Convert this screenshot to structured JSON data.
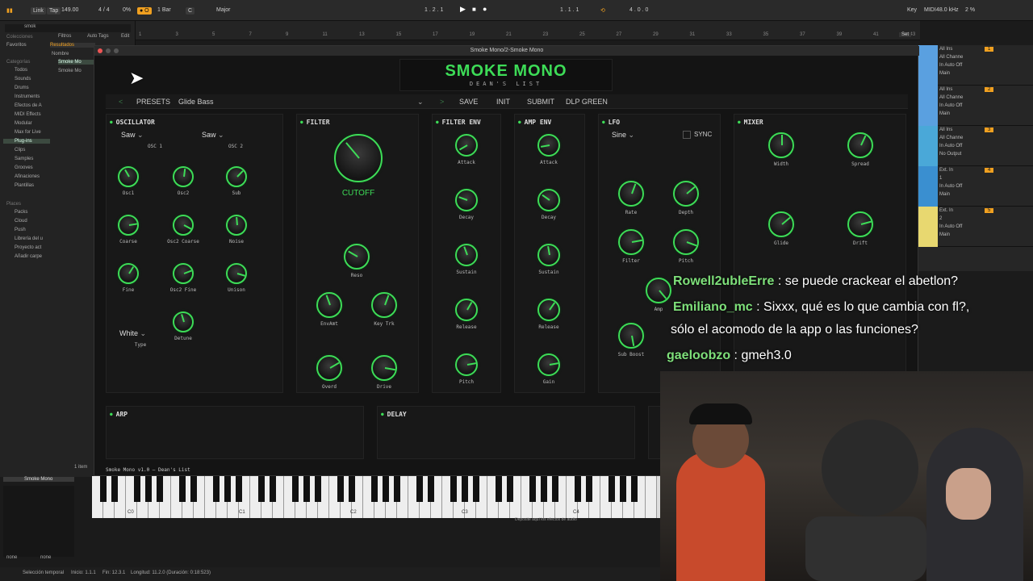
{
  "transport": {
    "link": "Link",
    "tap": "Tap",
    "tempo": "149.00",
    "sig": "4 / 4",
    "cpu": "0%",
    "quant": "1 Bar",
    "key": "C",
    "scale": "Major",
    "pos1": "1 . 2 . 1",
    "pos2": "1 . 1 . 1",
    "loop_len": "4 . 0 . 0",
    "key_label": "Key",
    "midi": "MIDI",
    "sr": "48.0 kHz",
    "load": "2 %"
  },
  "browser": {
    "search": "smok",
    "sections": {
      "collections": "Colecciones",
      "categories": "Categorías",
      "places": "Places"
    },
    "collections": [
      "Favoritos"
    ],
    "categories": [
      "Todos",
      "Sounds",
      "Drums",
      "Instruments",
      "Efectos de A",
      "MIDI Effects",
      "Modular",
      "Max for Live",
      "Plug-ins",
      "Clips",
      "Samples",
      "Grooves",
      "Afinaciones",
      "Plantillas"
    ],
    "places": [
      "Packs",
      "Cloud",
      "Push",
      "Librería del u",
      "Proyecto act",
      "Añadir carpe"
    ],
    "filters": "Filtros",
    "autotags": "Auto Tags",
    "edit": "Edit",
    "results_label": "Resultados",
    "name_col": "Nombre",
    "results": [
      "Smoke Mo",
      "Smoke Mo"
    ],
    "count": "1 item",
    "device_label": "Smoke Mono",
    "none1": "none",
    "none2": "none"
  },
  "ruler": {
    "marks": [
      "1",
      "3",
      "5",
      "7",
      "9",
      "11",
      "13",
      "15",
      "17",
      "19",
      "21",
      "23",
      "25",
      "27",
      "29",
      "31",
      "33",
      "35",
      "37",
      "39",
      "41",
      "43"
    ],
    "set": "Set"
  },
  "mixer": {
    "tracks": [
      {
        "in": "All Ins",
        "ch": "All Channe",
        "mode": "In Auto Off",
        "out": "Main",
        "num": "1",
        "color": "#5aa0e0"
      },
      {
        "in": "All Ins",
        "ch": "All Channe",
        "mode": "In Auto Off",
        "out": "Main",
        "num": "2",
        "color": "#5aa0e0"
      },
      {
        "in": "All Ins",
        "ch": "All Channe",
        "mode": "In Auto Off",
        "out": "No Output",
        "num": "3",
        "color": "#4aa8d8"
      },
      {
        "in": "Ext. In",
        "ch": "1",
        "mode": "In Auto Off",
        "out": "Main",
        "num": "4",
        "color": "#3a8fd0"
      },
      {
        "in": "Ext. In",
        "ch": "2",
        "mode": "In Auto Off",
        "out": "Main",
        "num": "5",
        "color": "#e8d870"
      }
    ],
    "clip_label": "ke Mon"
  },
  "plugin": {
    "window_title": "Smoke Mono/2-Smoke Mono",
    "logo": "SMOKE MONO",
    "sublogo": "DEAN'S LIST",
    "nav": {
      "prev": "<",
      "presets": "PRESETS",
      "preset_name": "Glide Bass",
      "next": ">",
      "save": "SAVE",
      "init": "INIT",
      "submit": "SUBMIT",
      "theme": "DLP GREEN"
    },
    "osc": {
      "title": "OSCILLATOR",
      "osc1": "Saw",
      "osc2": "Saw",
      "osc1_l": "OSC 1",
      "osc2_l": "OSC 2",
      "knobs": [
        "Osc1",
        "Osc2",
        "Sub",
        "Coarse",
        "Osc2 Coarse",
        "Noise",
        "Fine",
        "Osc2 Fine",
        "Unison",
        "Detune"
      ],
      "type_val": "White",
      "type_label": "Type"
    },
    "filter": {
      "title": "FILTER",
      "cutoff": "CUTOFF",
      "knobs": [
        "Reso",
        "EnvAmt",
        "Key Trk",
        "Overd",
        "Drive"
      ]
    },
    "fenv": {
      "title": "FILTER ENV",
      "knobs": [
        "Attack",
        "Decay",
        "Sustain",
        "Release",
        "Pitch"
      ]
    },
    "aenv": {
      "title": "AMP ENV",
      "knobs": [
        "Attack",
        "Decay",
        "Sustain",
        "Release",
        "Gain"
      ]
    },
    "lfo": {
      "title": "LFO",
      "shape": "Sine",
      "sync": "SYNC",
      "knobs": [
        "Rate",
        "Depth",
        "Filter",
        "Pitch",
        "Amp",
        "Sub Boost"
      ]
    },
    "mixer": {
      "title": "MIXER",
      "knobs": [
        "Width",
        "Spread",
        "Glide",
        "Drift"
      ]
    },
    "arp": "ARP",
    "delay": "DELAY",
    "version": "Smoke Mono v1.0  —  Dean's List"
  },
  "keyboard": {
    "labels": [
      "C0",
      "C1",
      "C2",
      "C3",
      "C4"
    ],
    "drop": "Deposite aquí los efectos de audio"
  },
  "footer": {
    "sel": "Selección temporal",
    "start": "Inicio: 1.1.1",
    "end": "Fin: 12.3.1",
    "len": "Longitud: 11.2.0 (Duración: 0:18:523)"
  },
  "chat": [
    {
      "user": "Rowell2ubleErre",
      "msg": " : se puede crackear el abetlon?"
    },
    {
      "user": "Emiliano_mc",
      "msg": " : Sixxx, qué es lo que cambia con fl?,"
    },
    {
      "user": "",
      "msg": "sólo el acomodo de la app o las funciones?"
    },
    {
      "user": "gaeloobzo",
      "msg": " : gmeh3.0"
    }
  ]
}
